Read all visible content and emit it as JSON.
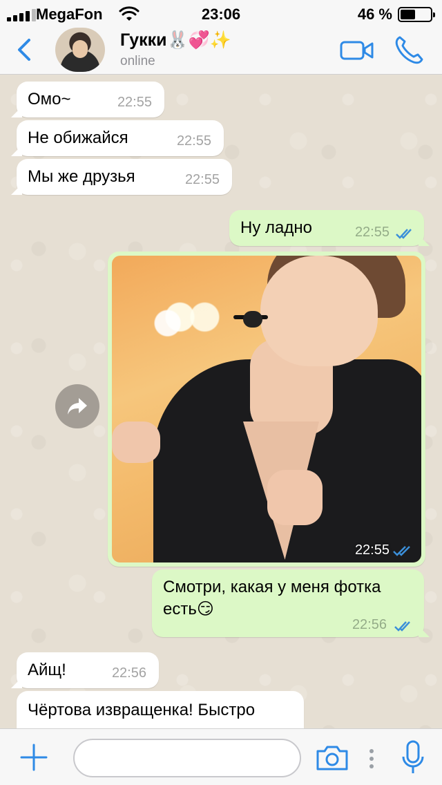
{
  "status_bar": {
    "carrier": "MegaFon",
    "time": "23:06",
    "battery": "46 %",
    "battery_level": 0.46
  },
  "header": {
    "back_icon": "chevron-left-icon",
    "contact_name": "Гукки🐰💞✨",
    "contact_status": "online",
    "accent_color": "#2e8ae6"
  },
  "messages": [
    {
      "direction": "in",
      "text": "Омо~",
      "time": "22:55"
    },
    {
      "direction": "in",
      "text": "Не обижайся",
      "time": "22:55"
    },
    {
      "direction": "in",
      "text": "Мы же друзья",
      "time": "22:55"
    },
    {
      "direction": "out",
      "text": "Ну ладно",
      "time": "22:55",
      "read": true
    },
    {
      "direction": "out",
      "type": "photo",
      "time": "22:55",
      "read": true
    },
    {
      "direction": "out",
      "text": "Смотри, какая у меня фотка есть😏",
      "time": "22:56",
      "read": true
    },
    {
      "direction": "in",
      "text": "Айщ!",
      "time": "22:56"
    },
    {
      "direction": "in",
      "text": "Чёртова извращенка! Быстро"
    }
  ],
  "input_bar": {
    "placeholder": "",
    "icons": [
      "plus-icon",
      "camera-icon",
      "more-dots-icon",
      "microphone-icon"
    ]
  },
  "colors": {
    "incoming_bubble": "#ffffff",
    "outgoing_bubble": "#dcf8c6",
    "read_ticks": "#3b8fd9",
    "chat_background": "#e6dfd3"
  }
}
